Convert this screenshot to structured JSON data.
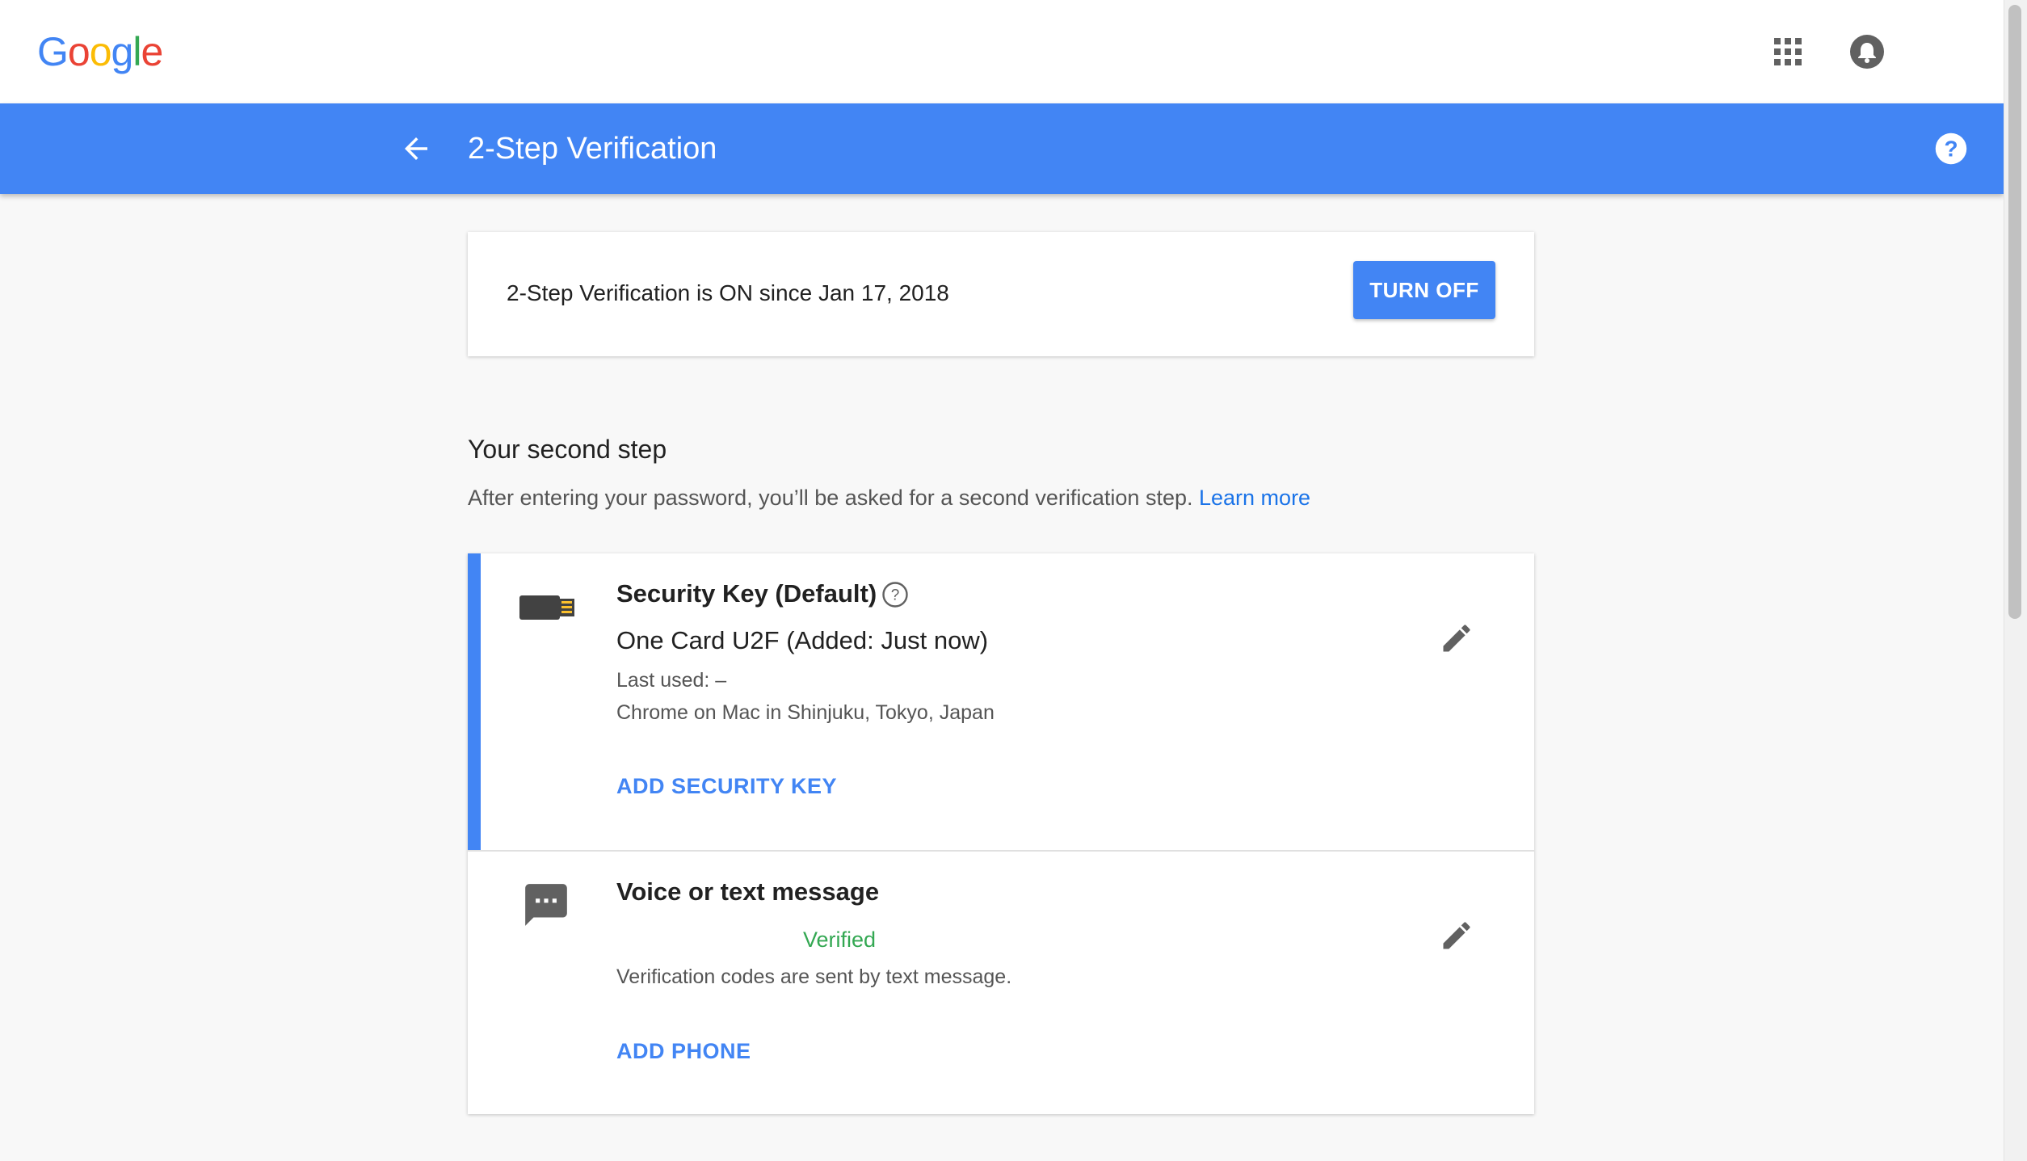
{
  "topbar": {
    "logo_letters": [
      {
        "char": "G",
        "color": "#4285f4"
      },
      {
        "char": "o",
        "color": "#ea4335"
      },
      {
        "char": "o",
        "color": "#fbbc05"
      },
      {
        "char": "g",
        "color": "#4285f4"
      },
      {
        "char": "l",
        "color": "#34a853"
      },
      {
        "char": "e",
        "color": "#ea4335"
      }
    ],
    "apps_icon": "apps-grid-icon",
    "account_icon": "account-avatar-icon"
  },
  "header": {
    "title": "2-Step Verification",
    "back_icon": "arrow-back-icon",
    "help_icon": "help-circle-icon",
    "color": "#4285f4"
  },
  "status": {
    "text": "2-Step Verification is ON since Jan 17, 2018",
    "button_label": "TURN OFF"
  },
  "second_step": {
    "title": "Your second step",
    "description": "After entering your password, you’ll be asked for a second verification step.",
    "learn_more": "Learn more"
  },
  "security_key": {
    "title": "Security Key (Default)",
    "name": "One Card U2F (Added: Just now)",
    "last_used": "Last used: –",
    "location": "Chrome on Mac in Shinjuku, Tokyo, Japan",
    "add_label": "ADD SECURITY KEY",
    "icon": "usb-key-icon"
  },
  "voice_text": {
    "title": "Voice or text message",
    "verified": "Verified",
    "description": "Verification codes are sent by text message.",
    "add_label": "ADD PHONE",
    "icon": "sms-icon"
  }
}
